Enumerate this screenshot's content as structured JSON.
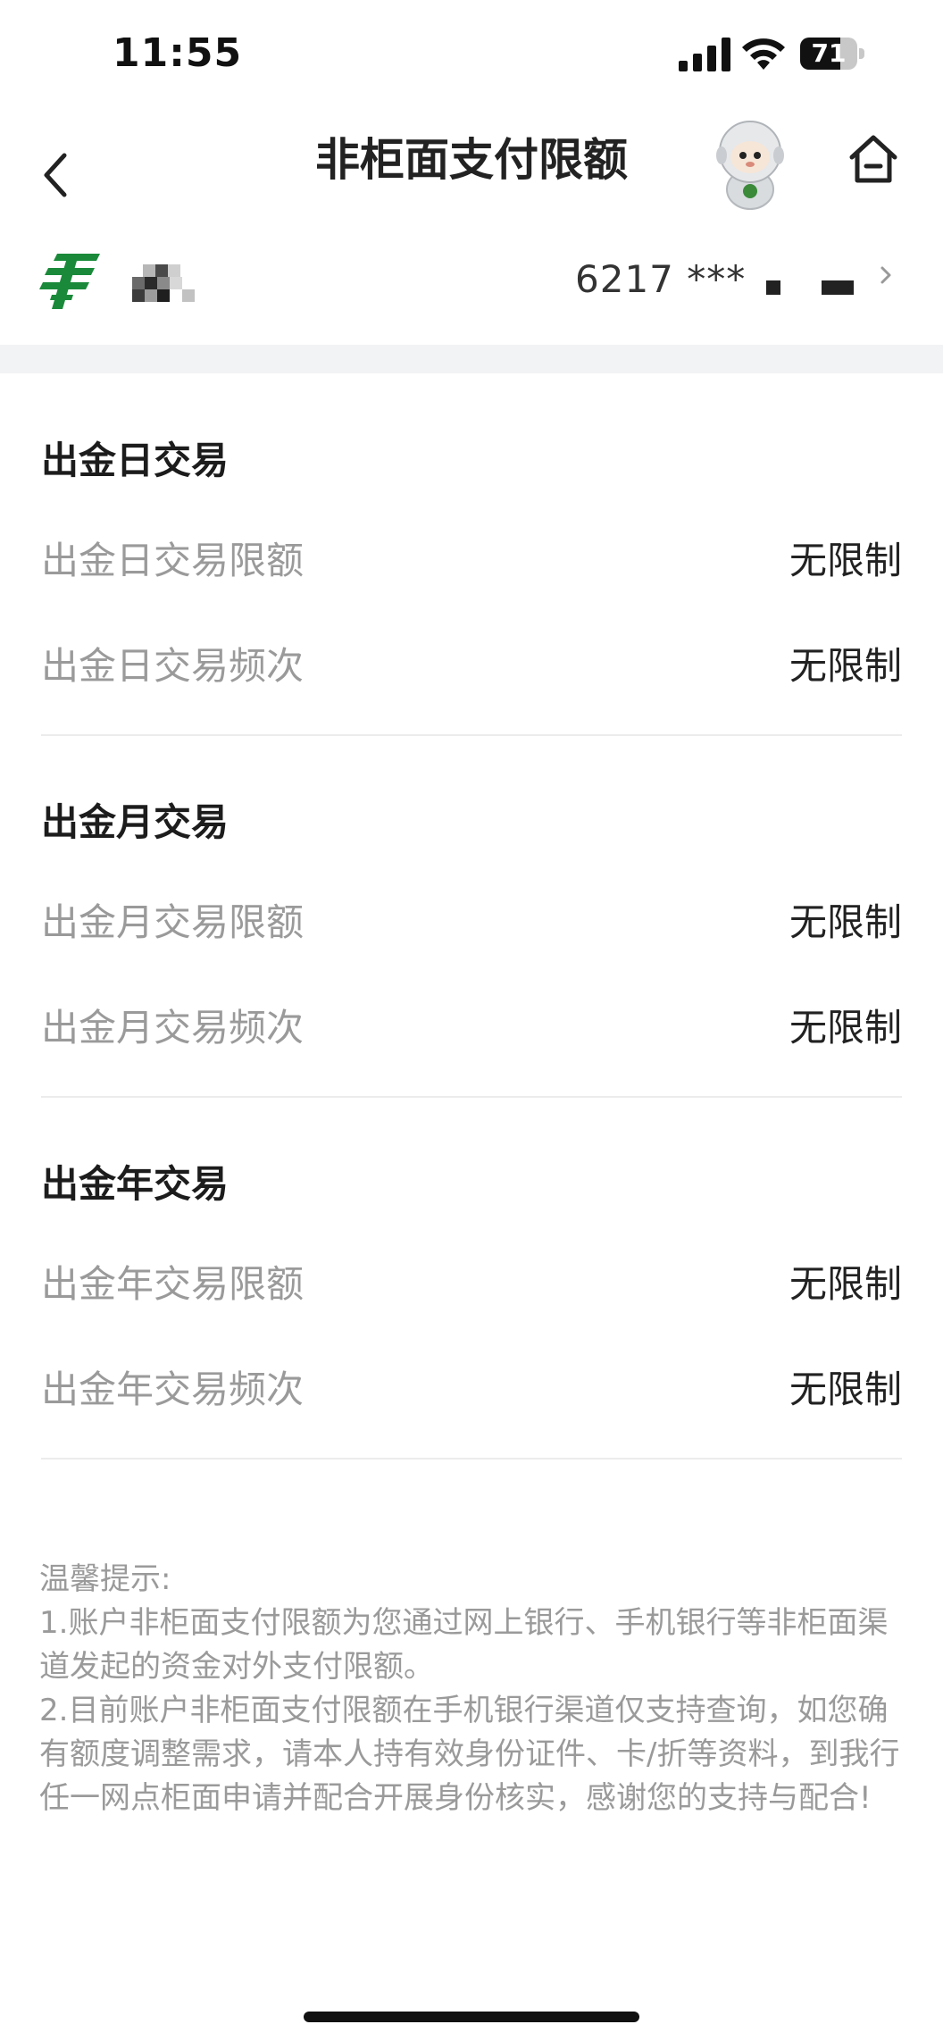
{
  "status_bar": {
    "time": "11:55",
    "battery": "71",
    "battery_level": 0.71
  },
  "header": {
    "title": "非柜面支付限额"
  },
  "account": {
    "card_number": "6217 ***"
  },
  "sections": [
    {
      "title": "出金日交易",
      "items": [
        {
          "label": "出金日交易限额",
          "value": "无限制"
        },
        {
          "label": "出金日交易频次",
          "value": "无限制"
        }
      ]
    },
    {
      "title": "出金月交易",
      "items": [
        {
          "label": "出金月交易限额",
          "value": "无限制"
        },
        {
          "label": "出金月交易频次",
          "value": "无限制"
        }
      ]
    },
    {
      "title": "出金年交易",
      "items": [
        {
          "label": "出金年交易限额",
          "value": "无限制"
        },
        {
          "label": "出金年交易频次",
          "value": "无限制"
        }
      ]
    }
  ],
  "tips": {
    "title": "温馨提示:",
    "lines": [
      "1.账户非柜面支付限额为您通过网上银行、手机银行等非柜面渠道发起的资金对外支付限额。",
      "2.目前账户非柜面支付限额在手机银行渠道仅支持查询，如您确有额度调整需求，请本人持有效身份证件、卡/折等资料，到我行任一网点柜面申请并配合开展身份核实，感谢您的支持与配合!"
    ]
  },
  "colors": {
    "brand_green": "#1a8a3a",
    "label_gray": "#9a9a9a",
    "separator": "#f2f3f5"
  }
}
